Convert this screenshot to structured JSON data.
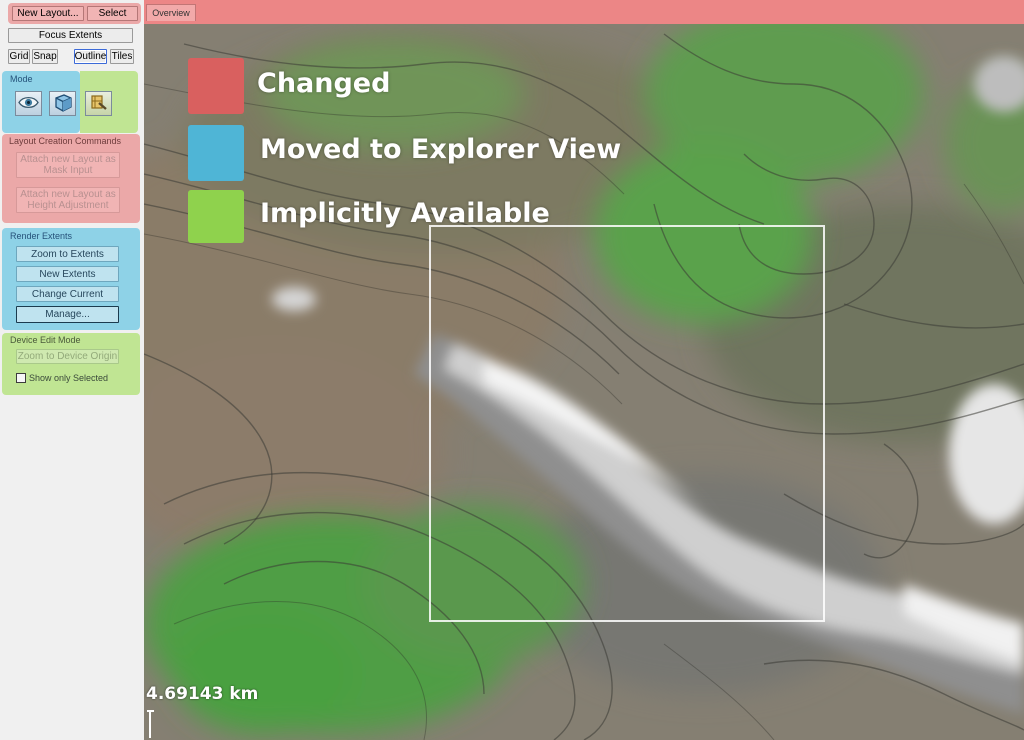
{
  "panel": {
    "top_buttons": {
      "new_layout": "New Layout...",
      "select": "Select",
      "focus_extents": "Focus Extents"
    },
    "view_toggles": {
      "grid": "Grid",
      "snap": "Snap",
      "outline": "Outline",
      "tiles": "Tiles"
    },
    "mode": {
      "title": "Mode",
      "buttons": [
        "eye-icon",
        "cube-icon",
        "layout-edit-icon"
      ]
    },
    "layout_creation": {
      "title": "Layout Creation Commands",
      "attach_mask": "Attach new Layout as Mask Input",
      "attach_height": "Attach new Layout as Height Adjustment"
    },
    "render_extents": {
      "title": "Render Extents",
      "zoom_to_extents": "Zoom to Extents",
      "new_extents": "New Extents",
      "change_current": "Change Current",
      "manage": "Manage..."
    },
    "device_edit": {
      "title": "Device Edit Mode",
      "zoom_to_origin": "Zoom to Device Origin",
      "show_only_selected": "Show only Selected",
      "show_only_selected_checked": false
    }
  },
  "tabs": [
    {
      "label": "Overview",
      "active": true
    }
  ],
  "legend": [
    {
      "label": "Changed",
      "color": "#d9605f"
    },
    {
      "label": "Moved to Explorer View",
      "color": "#4fb5d6"
    },
    {
      "label": "Implicitly Available",
      "color": "#8fd24d"
    }
  ],
  "scale": {
    "label": "4.69143 km"
  },
  "colors": {
    "changed": "#e86e6e",
    "moved": "#6ec8e4",
    "implicit": "#b2e278",
    "terrain_low": "#8c8a80",
    "terrain_green": "#4f9e45",
    "terrain_white": "#f4f4f4"
  }
}
